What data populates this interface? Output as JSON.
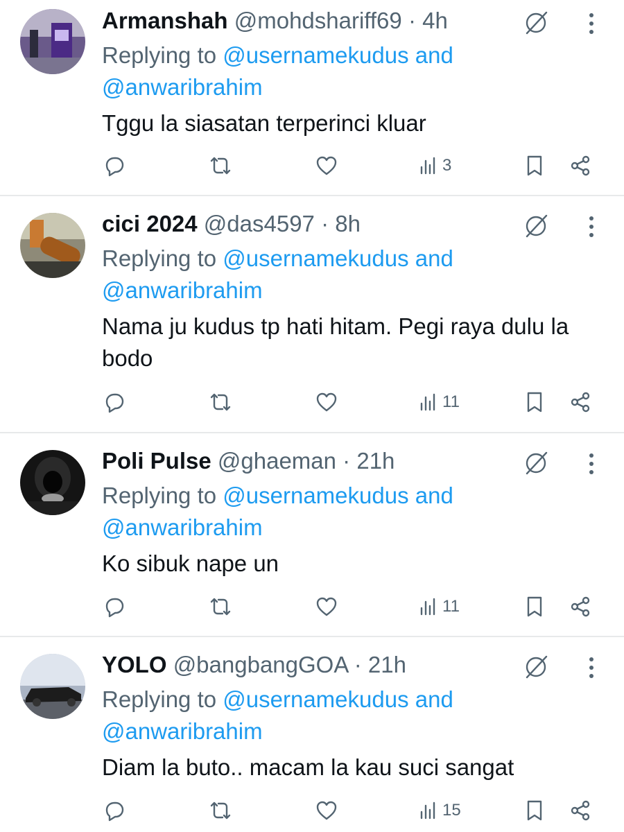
{
  "replying_prefix": "Replying to",
  "tweets": [
    {
      "name": "Armanshah",
      "handle": "@mohdshariff69",
      "separator": "·",
      "time": "4h",
      "mention_1": "@usernamekudus",
      "conjunction": "and",
      "mention_2": "@anwaribrahim",
      "text": "Tggu la siasatan terperinci kluar",
      "views": "3",
      "avatar_icon": "avatar-photo-kiosk"
    },
    {
      "name": "cici 2024",
      "handle": "@das4597",
      "separator": "·",
      "time": "8h",
      "mention_1": "@usernamekudus",
      "conjunction": "and",
      "mention_2": "@anwaribrahim",
      "text": "Nama ju kudus tp hati hitam. Pegi raya dulu la bodo",
      "views": "11",
      "avatar_icon": "avatar-photo-food"
    },
    {
      "name": "Poli Pulse",
      "handle": "@ghaeman",
      "separator": "·",
      "time": "21h",
      "mention_1": "@usernamekudus",
      "conjunction": "and",
      "mention_2": "@anwaribrahim",
      "text": "Ko sibuk nape un",
      "views": "11",
      "avatar_icon": "avatar-photo-hooded-figure"
    },
    {
      "name": "YOLO",
      "handle": "@bangbangGOA",
      "separator": "·",
      "time": "21h",
      "mention_1": "@usernamekudus",
      "conjunction": "and",
      "mention_2": "@anwaribrahim",
      "text": "Diam la buto.. macam la kau suci sangat",
      "views": "15",
      "avatar_icon": "avatar-photo-car"
    }
  ],
  "colors": {
    "text": "#0f1419",
    "secondary": "#536471",
    "link": "#1d9bf0",
    "divider": "#e7e9ea"
  },
  "icons": [
    "grok-icon",
    "more-icon",
    "reply-icon",
    "retweet-icon",
    "like-icon",
    "views-icon",
    "bookmark-icon",
    "share-icon"
  ]
}
